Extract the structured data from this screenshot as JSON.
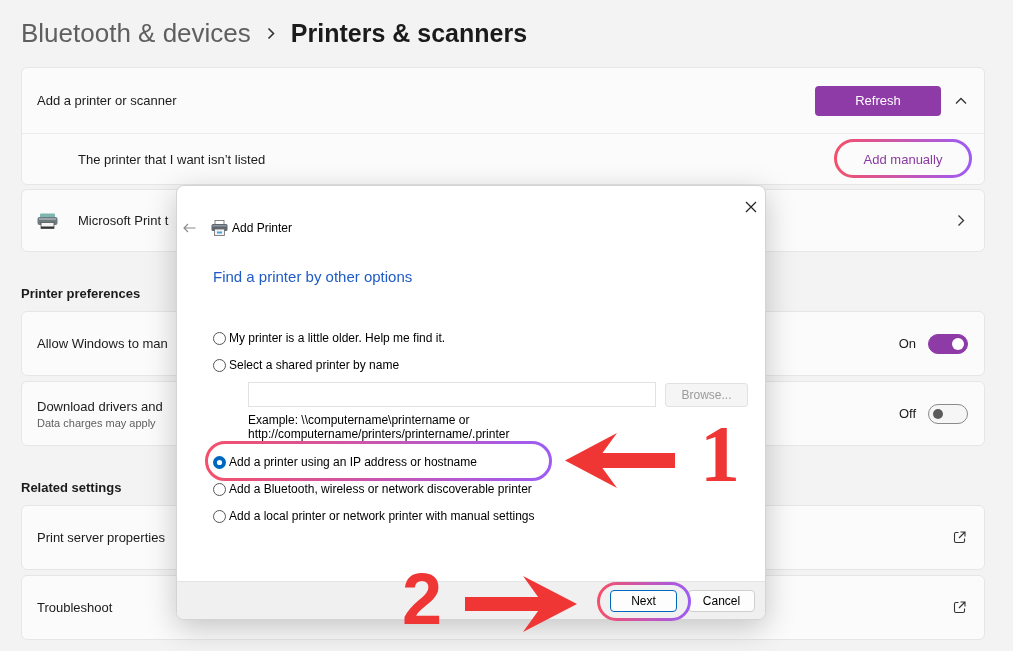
{
  "breadcrumb": [
    {
      "label": "Bluetooth & devices",
      "current": false
    },
    {
      "label": "Printers & scanners",
      "current": true
    }
  ],
  "add_card": {
    "title": "Add a printer or scanner",
    "refresh_button": "Refresh",
    "expanded": true,
    "not_listed_label": "The printer that I want isn’t listed",
    "add_manually_button": "Add manually"
  },
  "printers": [
    {
      "name": "Microsoft Print t"
    }
  ],
  "sections": [
    {
      "heading": "Printer preferences",
      "rows": [
        {
          "kind": "toggle",
          "label": "Allow Windows to man",
          "state_label": "On",
          "on": true
        },
        {
          "kind": "toggle",
          "label": "Download drivers and",
          "description": "Data charges may apply",
          "state_label": "Off",
          "on": false
        }
      ]
    },
    {
      "heading": "Related settings",
      "rows": [
        {
          "kind": "link",
          "label": "Print server properties"
        },
        {
          "kind": "link",
          "label": "Troubleshoot"
        }
      ]
    }
  ],
  "dialog": {
    "title": "Add Printer",
    "heading": "Find a printer by other options",
    "options": [
      {
        "label": "My printer is a little older. Help me find it.",
        "selected": false
      },
      {
        "label": "Select a shared printer by name",
        "selected": false,
        "name_field": {
          "disabled": true,
          "browse_button": {
            "label": "Browse...",
            "disabled": true
          },
          "example": "Example: \\\\computername\\printername or http://computername/printers/printername/.printer"
        }
      },
      {
        "label": "Add a printer using an IP address or hostname",
        "selected": true
      },
      {
        "label": "Add a Bluetooth, wireless or network discoverable printer",
        "selected": false
      },
      {
        "label": "Add a local printer or network printer with manual settings",
        "selected": false
      }
    ],
    "buttons": [
      {
        "label": "Next",
        "default": true
      },
      {
        "label": "Cancel",
        "default": false
      }
    ]
  },
  "annotations": [
    {
      "kind": "ring"
    },
    {
      "kind": "ring"
    },
    {
      "kind": "left",
      "label": "1"
    },
    {
      "kind": "right",
      "label": "2"
    },
    {
      "kind": "ring"
    }
  ]
}
